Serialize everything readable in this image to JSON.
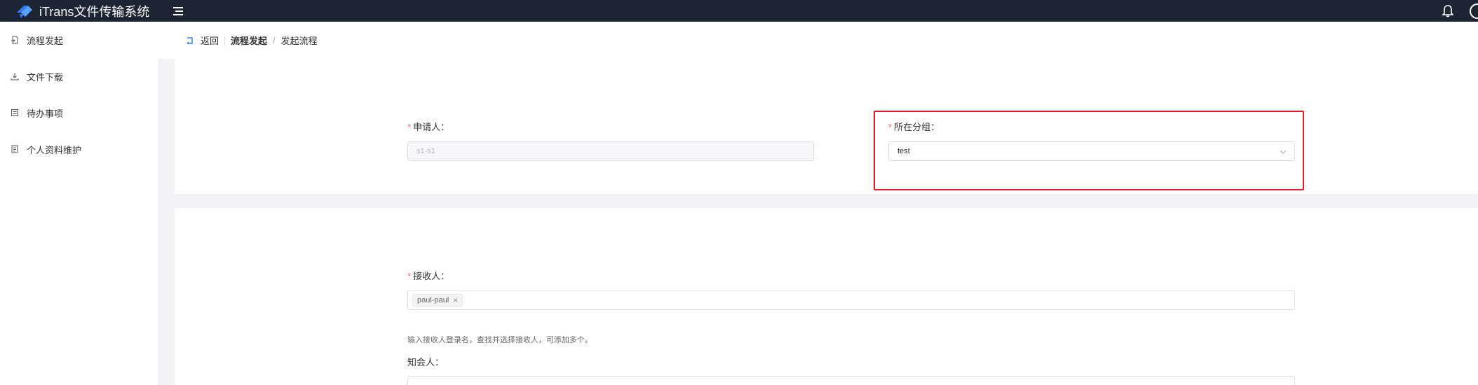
{
  "app": {
    "title": "iTrans文件传输系统",
    "accent": "#2f7cf6",
    "topbar_bg": "#1d2433",
    "highlight_color": "#e11e1e"
  },
  "sidebar": {
    "items": [
      {
        "label": "流程发起",
        "icon": "file-send-icon"
      },
      {
        "label": "文件下载",
        "icon": "download-icon"
      },
      {
        "label": "待办事项",
        "icon": "todo-list-icon"
      },
      {
        "label": "个人资料维护",
        "icon": "profile-icon"
      }
    ]
  },
  "breadcrumb": {
    "back_label": "返回",
    "parent": "流程发起",
    "separator": "/",
    "current": "发起流程"
  },
  "form": {
    "applicant": {
      "label": "申请人：",
      "value": "s1-s1"
    },
    "group": {
      "label": "所在分组：",
      "value": "test"
    },
    "receiver": {
      "label": "接收人：",
      "tags": [
        "paul-paul"
      ],
      "hint": "输入接收人登录名，查找并选择接收人，可添加多个。"
    },
    "cc": {
      "label": "知会人："
    },
    "required_mark": "*"
  }
}
